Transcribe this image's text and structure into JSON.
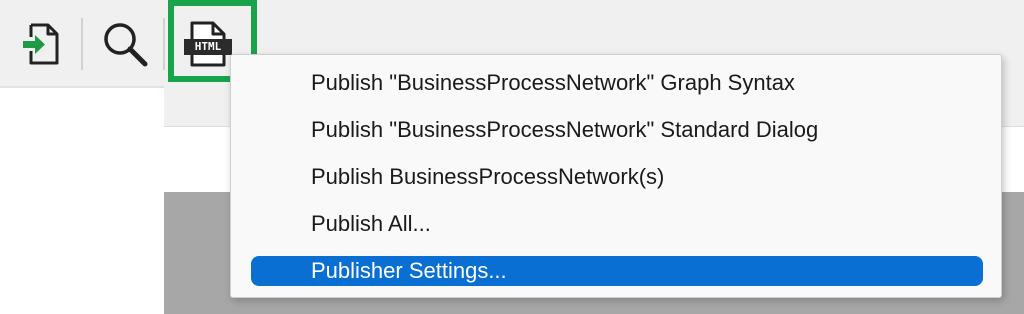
{
  "toolbar": {
    "buttons": [
      {
        "icon": "import-icon"
      },
      {
        "icon": "search-icon"
      },
      {
        "icon": "html-export-icon",
        "badge_text": "HTML"
      }
    ]
  },
  "menu": {
    "items": [
      {
        "label": "Publish \"BusinessProcessNetwork\" Graph Syntax"
      },
      {
        "label": "Publish \"BusinessProcessNetwork\" Standard Dialog"
      },
      {
        "label": "Publish BusinessProcessNetwork(s)"
      },
      {
        "label": "Publish All..."
      },
      {
        "label": "Publisher Settings..."
      }
    ],
    "selected_index": 4
  },
  "colors": {
    "highlight_border": "#19a34a",
    "selected_item_bg": "#0a6fd2",
    "icon_accent": "#1e9a44"
  }
}
